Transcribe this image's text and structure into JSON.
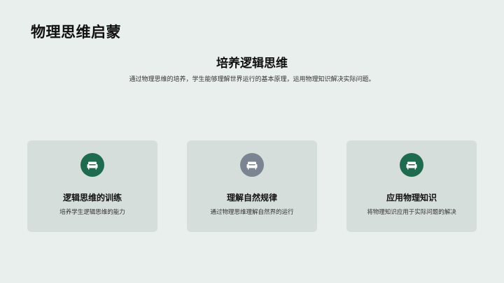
{
  "header": {
    "title": "物理思维启蒙"
  },
  "section": {
    "title": "培养逻辑思维",
    "description": "通过物理思维的培养，学生能够理解世界运行的基本原理，运用物理知识解决实际问题。"
  },
  "cards": [
    {
      "title": "逻辑思维的训练",
      "description": "培养学生逻辑思维的能力",
      "icon": "sofa-icon",
      "icon_color": "#1e6b4f"
    },
    {
      "title": "理解自然规律",
      "description": "通过物理思维理解自然界的运行",
      "icon": "sofa-icon",
      "icon_color": "#7b8591"
    },
    {
      "title": "应用物理知识",
      "description": "将物理知识应用于实际问题的解决",
      "icon": "sofa-icon",
      "icon_color": "#1e6b4f"
    }
  ]
}
